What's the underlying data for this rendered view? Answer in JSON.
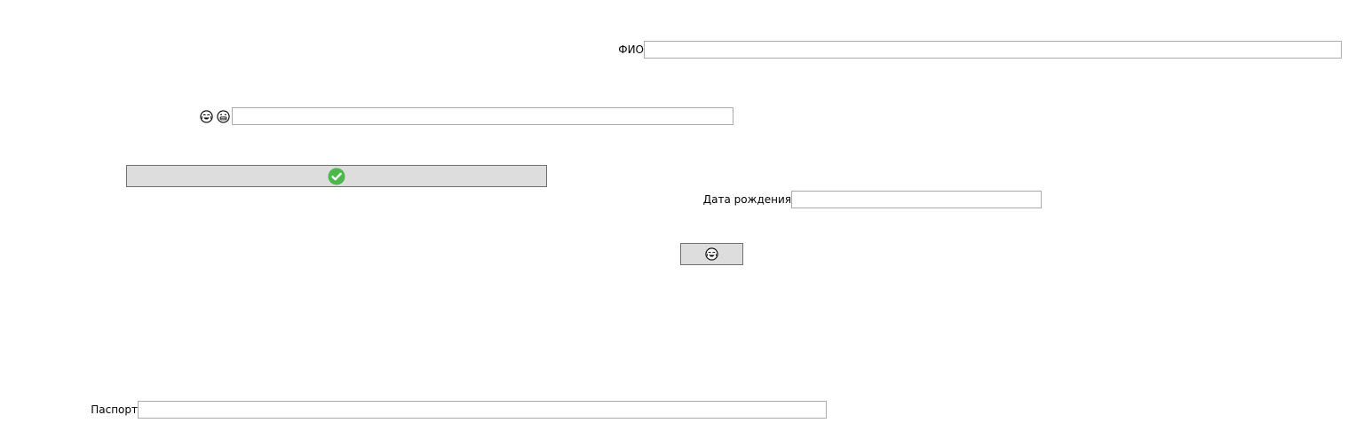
{
  "form": {
    "fio": {
      "label": "ФИО",
      "value": ""
    },
    "emoji_field": {
      "label_icons": [
        "smiling-face-with-tears-icon",
        "grinning-face-icon"
      ],
      "value": ""
    },
    "birth_date": {
      "label": "Дата рождения",
      "value": ""
    },
    "passport": {
      "label": "Паспорт",
      "value": ""
    }
  },
  "buttons": {
    "confirm": {
      "icon": "check-circle-icon",
      "color": "#4cb84c"
    },
    "emoji": {
      "icon": "laughing-face-icon"
    }
  }
}
